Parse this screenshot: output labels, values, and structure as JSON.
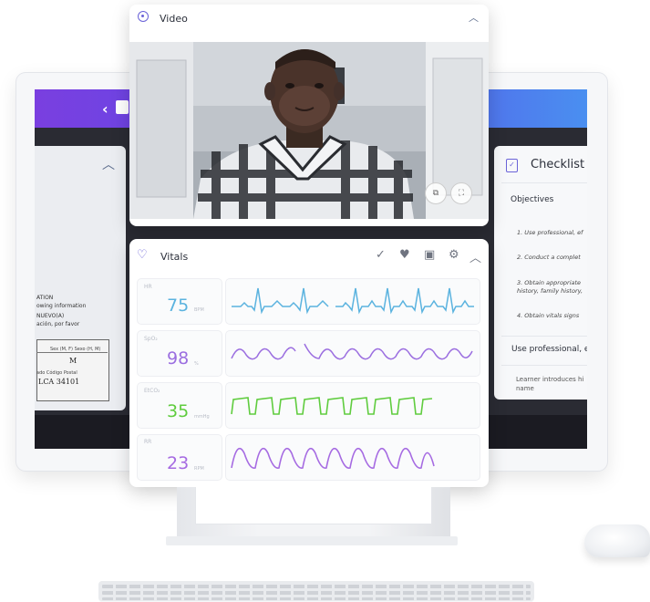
{
  "colors": {
    "accent": "#6b63d8",
    "hr": "#5bb3df",
    "spo2": "#9b6ee0",
    "etco2": "#5fcc3e",
    "rr": "#a66be2"
  },
  "left_doc": {
    "lines": [
      "ATION",
      "owing information",
      "NUEVO(A)",
      "ación, por favor"
    ],
    "cells": [
      "Sex (M, F) Sexo (H, M)",
      "M",
      "ado Código Postal",
      "LCA   34101"
    ]
  },
  "checklist": {
    "title": "Checklist",
    "objectives_title": "Objectives",
    "items": [
      "1. Use professional, ef",
      "2. Conduct a complet",
      "3. Obtain appropriate",
      "history, family history,",
      "4. Obtain vitals signs"
    ],
    "section_title": "Use professional, ef",
    "learner_text": [
      "Learner introduces hi",
      "name"
    ]
  },
  "video": {
    "title": "Video",
    "icon": "webcam-icon"
  },
  "vitals": {
    "title": "Vitals",
    "toolbar_icons": [
      "check-icon",
      "heart-icon",
      "monitor-icon",
      "gear-icon",
      "chevron-up-icon"
    ],
    "metrics": [
      {
        "label": "HR",
        "value": "75",
        "unit": "BPM"
      },
      {
        "label": "SpO₂",
        "value": "98",
        "unit": "%"
      },
      {
        "label": "EtCO₂",
        "value": "35",
        "unit": "mmHg"
      },
      {
        "label": "RR",
        "value": "23",
        "unit": "RPM"
      }
    ]
  }
}
